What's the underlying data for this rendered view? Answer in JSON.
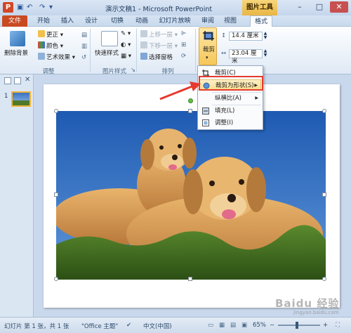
{
  "titlebar": {
    "app_logo": "P",
    "title": "演示文稿1 - Microsoft PowerPoint",
    "context_tab": "图片工具",
    "minimize": "–",
    "maximize": "□",
    "close": "✕"
  },
  "tabs": {
    "file": "文件",
    "items": [
      "开始",
      "插入",
      "设计",
      "切换",
      "动画",
      "幻灯片放映",
      "审阅",
      "视图",
      "格式"
    ],
    "active": "格式"
  },
  "ribbon": {
    "remove_bg": "删除背景",
    "corrections": "更正",
    "color": "颜色",
    "artistic": "艺术效果",
    "adjust_group": "调整",
    "quick_styles": "快速样式",
    "picture_styles_group": "图片样式",
    "bring_forward": "上移一层",
    "send_backward": "下移一层",
    "selection_pane": "选择窗格",
    "arrange_group": "排列",
    "crop": "裁剪",
    "height": "14.4 厘米",
    "width": "23.04 厘米"
  },
  "crop_menu": {
    "items": [
      {
        "label": "裁剪(C)",
        "icon": "crop-icon"
      },
      {
        "label": "裁剪为形状(S)",
        "icon": "shape-crop-icon",
        "submenu": true,
        "highlighted": true
      },
      {
        "label": "纵横比(A)",
        "icon": "aspect-ratio-icon",
        "submenu": true
      },
      {
        "label": "填充(L)",
        "icon": "fill-icon"
      },
      {
        "label": "调整(I)",
        "icon": "fit-icon"
      }
    ]
  },
  "left_panel": {
    "slide_number": "1"
  },
  "statusbar": {
    "slide_info": "幻灯片 第 1 张，共 1 张",
    "theme": "\"Office 主题\"",
    "language": "中文(中国)",
    "zoom": "65%",
    "zoom_minus": "−",
    "zoom_plus": "+"
  },
  "watermark": {
    "main": "Baidu 经验",
    "sub": "jingyan.baidu.com"
  },
  "colors": {
    "file_tab": "#c94a21",
    "context_tab": "#e9b644",
    "highlight_border": "#e53a2e",
    "sky": "#2f6fc4",
    "grass": "#3f6b22"
  }
}
